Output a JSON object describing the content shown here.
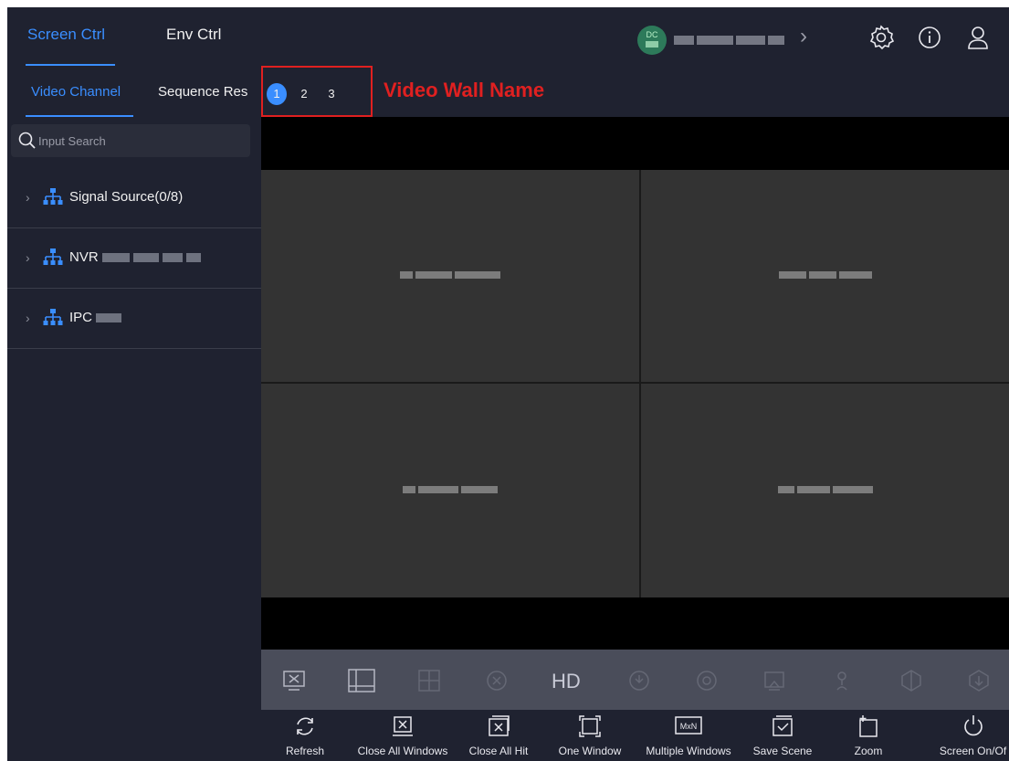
{
  "top_tabs": [
    {
      "label": "Screen Ctrl",
      "active": true
    },
    {
      "label": "Env Ctrl",
      "active": false
    }
  ],
  "device": {
    "badge_label": "DC",
    "icon": "device-badge-icon"
  },
  "top_icons": [
    "settings-icon",
    "info-icon",
    "user-icon"
  ],
  "sub_tabs": [
    {
      "label": "Video Channel",
      "active": true
    },
    {
      "label": "Sequence Res",
      "active": false
    }
  ],
  "wall_pages": [
    "1",
    "2",
    "3"
  ],
  "wall_annotation": "Video Wall Name",
  "search": {
    "placeholder": "Input Search"
  },
  "tree": [
    {
      "label": "Signal Source(0/8)"
    },
    {
      "label": "NVR"
    },
    {
      "label": "IPC"
    }
  ],
  "toolbar": {
    "hd_label": "HD"
  },
  "actions": [
    {
      "label": "Refresh",
      "icon": "refresh-icon"
    },
    {
      "label": "Close All Windows",
      "icon": "close-all-windows-icon"
    },
    {
      "label": "Close All Hit",
      "icon": "close-all-hit-icon"
    },
    {
      "label": "One Window",
      "icon": "one-window-icon"
    },
    {
      "label": "Multiple Windows",
      "icon": "multiple-windows-icon"
    },
    {
      "label": "Save Scene",
      "icon": "save-scene-icon"
    },
    {
      "label": "Zoom",
      "icon": "zoom-icon"
    },
    {
      "label": "Screen On/Of",
      "icon": "power-icon"
    }
  ],
  "multiple_windows_icon_text": "MxN",
  "colors": {
    "accent": "#3a8eff",
    "annotation": "#e02020",
    "background": "#1f2230"
  }
}
